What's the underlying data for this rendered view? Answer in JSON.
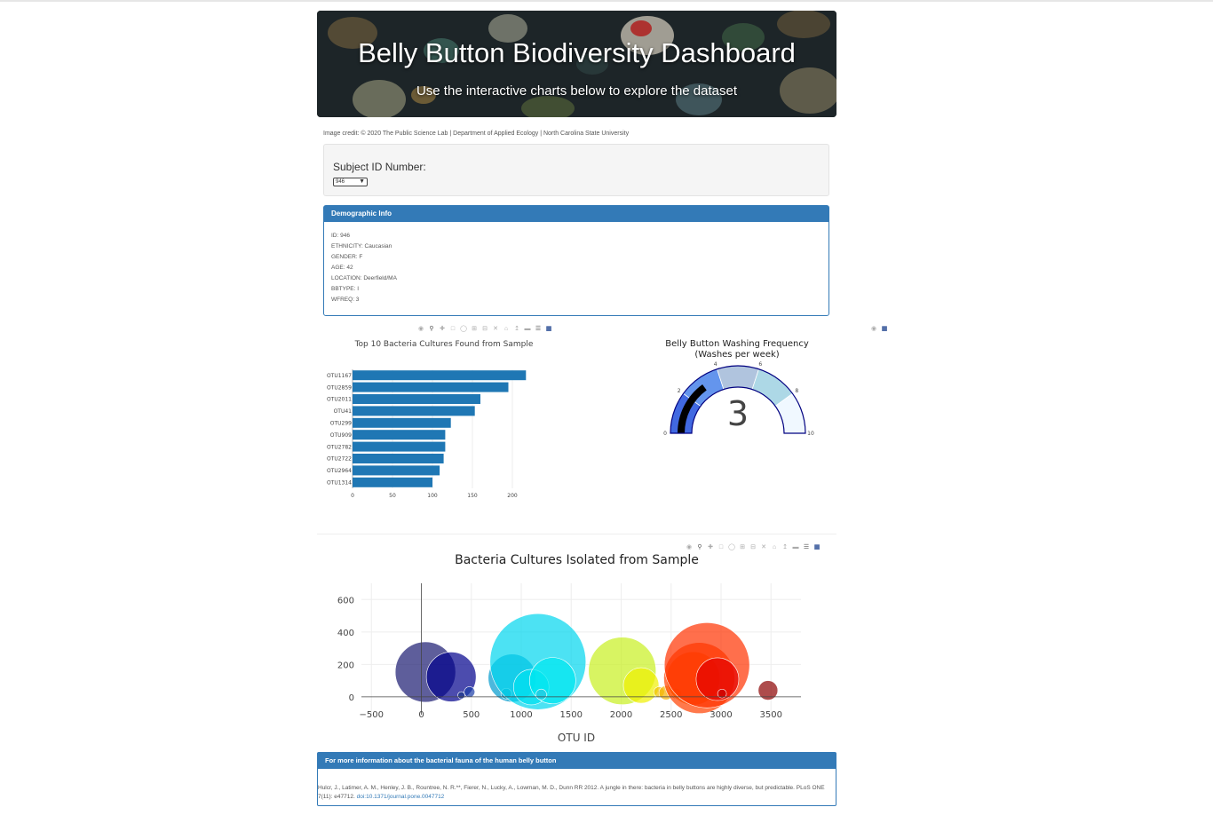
{
  "header": {
    "title": "Belly Button Biodiversity Dashboard",
    "subtitle": "Use the interactive charts below to explore the dataset"
  },
  "credit": "Image credit: © 2020 The Public Science Lab | Department of Applied Ecology | North Carolina State University",
  "selector": {
    "label": "Subject ID Number:",
    "selected": "946"
  },
  "demographic": {
    "heading": "Demographic Info",
    "lines": [
      "ID: 946",
      "ETHNICITY: Caucasian",
      "GENDER: F",
      "AGE: 42",
      "LOCATION: Deerfield/MA",
      "BBTYPE: I",
      "WFREQ: 3"
    ]
  },
  "colors": {
    "accent": "#337ab7",
    "bar": "#1f77b4",
    "gauge_needle": "#000000"
  },
  "bar_chart": {
    "title": "Top 10 Bacteria Cultures Found from Sample"
  },
  "gauge": {
    "title_line1": "Belly Button Washing Frequency",
    "title_line2": "(Washes per week)",
    "value_label": "3"
  },
  "bubble": {
    "title": "Bacteria Cultures Isolated from Sample",
    "xlabel": "OTU ID"
  },
  "footer": {
    "heading": "For more information about the bacterial fauna of the human belly button",
    "citation": "Hulcr, J., Latimer, A. M., Henley, J. B., Rountree, N. R.**, Fierer, N., Lucky, A., Lowman, M. D., Dunn RR 2012. A jungle in there: bacteria in belly buttons are highly diverse, but predictable. PLoS ONE 7(11): e47712.",
    "doi": "doi:10.1371/journal.pone.0047712"
  },
  "modebar_icons": [
    "camera-icon",
    "zoom-icon",
    "pan-icon",
    "box-select-icon",
    "lasso-icon",
    "zoom-in-icon",
    "zoom-out-icon",
    "autoscale-icon",
    "reset-axes-icon",
    "spike-lines-icon",
    "hover-closest-icon",
    "hover-compare-icon",
    "plotly-logo-icon"
  ],
  "chart_data": [
    {
      "type": "bar",
      "orientation": "horizontal",
      "title": "Top 10 Bacteria Cultures Found from Sample",
      "categories": [
        "OTU1167",
        "OTU2859",
        "OTU2011",
        "OTU41",
        "OTU299",
        "OTU909",
        "OTU2782",
        "OTU2722",
        "OTU2964",
        "OTU1314"
      ],
      "values": [
        217,
        195,
        160,
        153,
        123,
        116,
        116,
        114,
        109,
        100
      ],
      "xticks": [
        "0",
        "50",
        "100",
        "150",
        "200"
      ],
      "xlim": [
        0,
        220
      ]
    },
    {
      "type": "gauge",
      "title": "Belly Button Washing Frequency (Washes per week)",
      "value": 3,
      "range": [
        0,
        10
      ],
      "ticks": [
        "0",
        "2",
        "4",
        "6",
        "8",
        "10"
      ],
      "steps": [
        {
          "range": [
            0,
            2
          ],
          "color": "#4169e1"
        },
        {
          "range": [
            2,
            4
          ],
          "color": "#6495ed"
        },
        {
          "range": [
            4,
            6
          ],
          "color": "#b0c4de"
        },
        {
          "range": [
            6,
            8
          ],
          "color": "#add8e6"
        },
        {
          "range": [
            8,
            10
          ],
          "color": "#f0f8ff"
        }
      ]
    },
    {
      "type": "scatter",
      "mode": "bubble",
      "title": "Bacteria Cultures Isolated from Sample",
      "xlabel": "OTU ID",
      "xticks": [
        "−500",
        "0",
        "500",
        "1000",
        "1500",
        "2000",
        "2500",
        "3000",
        "3500"
      ],
      "yticks": [
        "0",
        "200",
        "400",
        "600"
      ],
      "xlim": [
        -600,
        3800
      ],
      "ylim": [
        -110,
        700
      ],
      "points": [
        {
          "x": 41,
          "y": 153,
          "r": 34,
          "color": "#191970"
        },
        {
          "x": 299,
          "y": 123,
          "r": 28,
          "color": "#00008b"
        },
        {
          "x": 400,
          "y": 10,
          "r": 4,
          "color": "#1e3a8a"
        },
        {
          "x": 482,
          "y": 30,
          "r": 6,
          "color": "#1c3fa8"
        },
        {
          "x": 909,
          "y": 116,
          "r": 27,
          "color": "#009acd"
        },
        {
          "x": 850,
          "y": 20,
          "r": 6,
          "color": "#0aa0c8"
        },
        {
          "x": 1167,
          "y": 217,
          "r": 54,
          "color": "#00d5ee"
        },
        {
          "x": 1100,
          "y": 60,
          "r": 20,
          "color": "#00e1f0"
        },
        {
          "x": 1314,
          "y": 100,
          "r": 26,
          "color": "#00e8ef"
        },
        {
          "x": 1200,
          "y": 15,
          "r": 6,
          "color": "#2bc8e0"
        },
        {
          "x": 2011,
          "y": 160,
          "r": 38,
          "color": "#c8f020"
        },
        {
          "x": 2200,
          "y": 70,
          "r": 20,
          "color": "#f0f000"
        },
        {
          "x": 2380,
          "y": 30,
          "r": 6,
          "color": "#f0c000"
        },
        {
          "x": 2450,
          "y": 25,
          "r": 8,
          "color": "#f5b000"
        },
        {
          "x": 2550,
          "y": 20,
          "r": 6,
          "color": "#f59a00"
        },
        {
          "x": 2722,
          "y": 114,
          "r": 30,
          "color": "#ff7000"
        },
        {
          "x": 2782,
          "y": 116,
          "r": 40,
          "color": "#ff4000"
        },
        {
          "x": 2859,
          "y": 195,
          "r": 48,
          "color": "#ff3200"
        },
        {
          "x": 2964,
          "y": 109,
          "r": 24,
          "color": "#e40000"
        },
        {
          "x": 3010,
          "y": 20,
          "r": 5,
          "color": "#c80000"
        },
        {
          "x": 3470,
          "y": 40,
          "r": 11,
          "color": "#8b0000"
        }
      ]
    }
  ]
}
